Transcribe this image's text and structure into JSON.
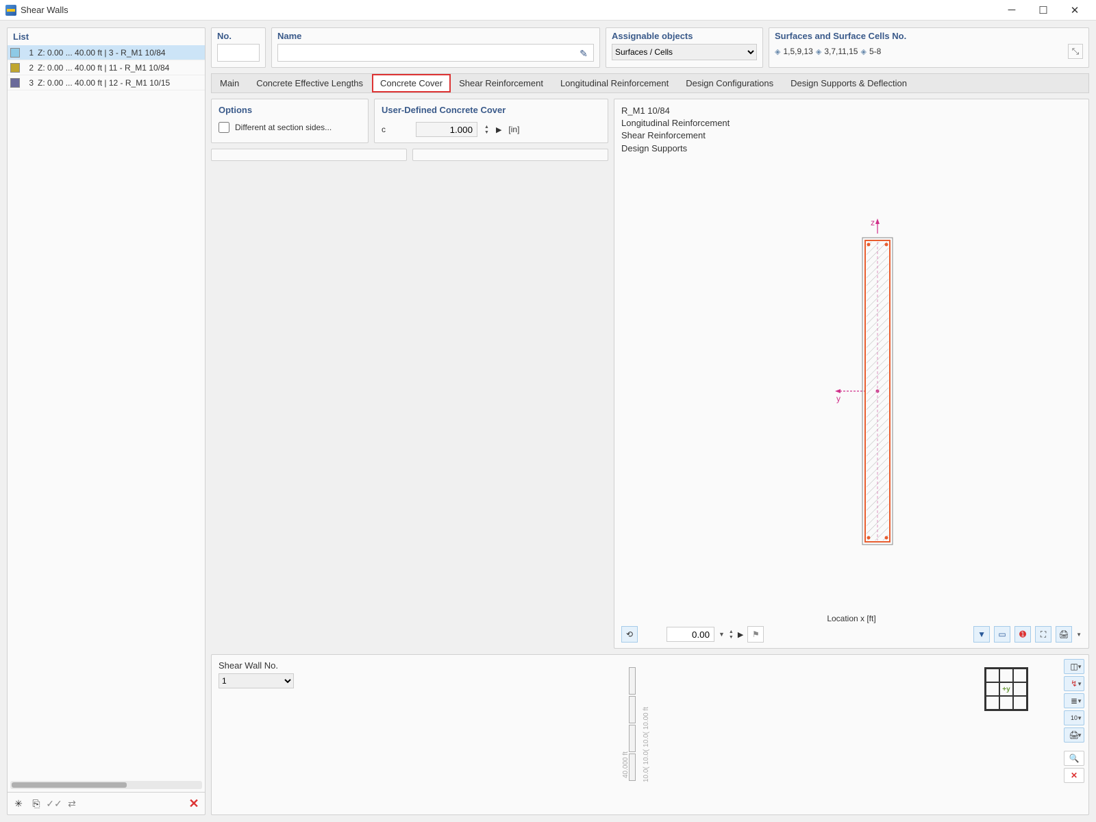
{
  "window": {
    "title": "Shear Walls"
  },
  "list": {
    "header": "List",
    "items": [
      {
        "idx": "1",
        "text": "Z: 0.00 ... 40.00 ft | 3 - R_M1 10/84",
        "color": "#8ecae6",
        "selected": true
      },
      {
        "idx": "2",
        "text": "Z: 0.00 ... 40.00 ft | 11 - R_M1 10/84",
        "color": "#c0a62f",
        "selected": false
      },
      {
        "idx": "3",
        "text": "Z: 0.00 ... 40.00 ft | 12 - R_M1 10/15",
        "color": "#6a6a9a",
        "selected": false
      }
    ]
  },
  "header": {
    "no_label": "No.",
    "name_label": "Name",
    "name_value": "",
    "assignable_label": "Assignable objects",
    "assignable_value": "Surfaces / Cells",
    "surfaces_label": "Surfaces and Surface Cells No.",
    "surfaces_groups": [
      "1,5,9,13",
      "3,7,11,15",
      "5-8"
    ]
  },
  "tabs": {
    "items": [
      "Main",
      "Concrete Effective Lengths",
      "Concrete Cover",
      "Shear Reinforcement",
      "Longitudinal Reinforcement",
      "Design Configurations",
      "Design Supports & Deflection"
    ],
    "active_index": 2
  },
  "options": {
    "header": "Options",
    "different_sides": "Different at section sides..."
  },
  "cover": {
    "header": "User-Defined Concrete Cover",
    "param_name": "c",
    "param_value": "1.000",
    "param_unit": "[in]"
  },
  "preview": {
    "lines": [
      "R_M1 10/84",
      "Longitudinal Reinforcement",
      "Shear Reinforcement",
      "Design Supports"
    ],
    "axis_z": "z",
    "axis_y": "y",
    "location_label": "Location x [ft]",
    "location_value": "0.00"
  },
  "bottom": {
    "label": "Shear Wall No.",
    "value": "1",
    "axis_label": "+y",
    "elev_main": "40.000 ft",
    "elev_segs": "10.0( 10.0( 10.0( 10.00 ft"
  }
}
